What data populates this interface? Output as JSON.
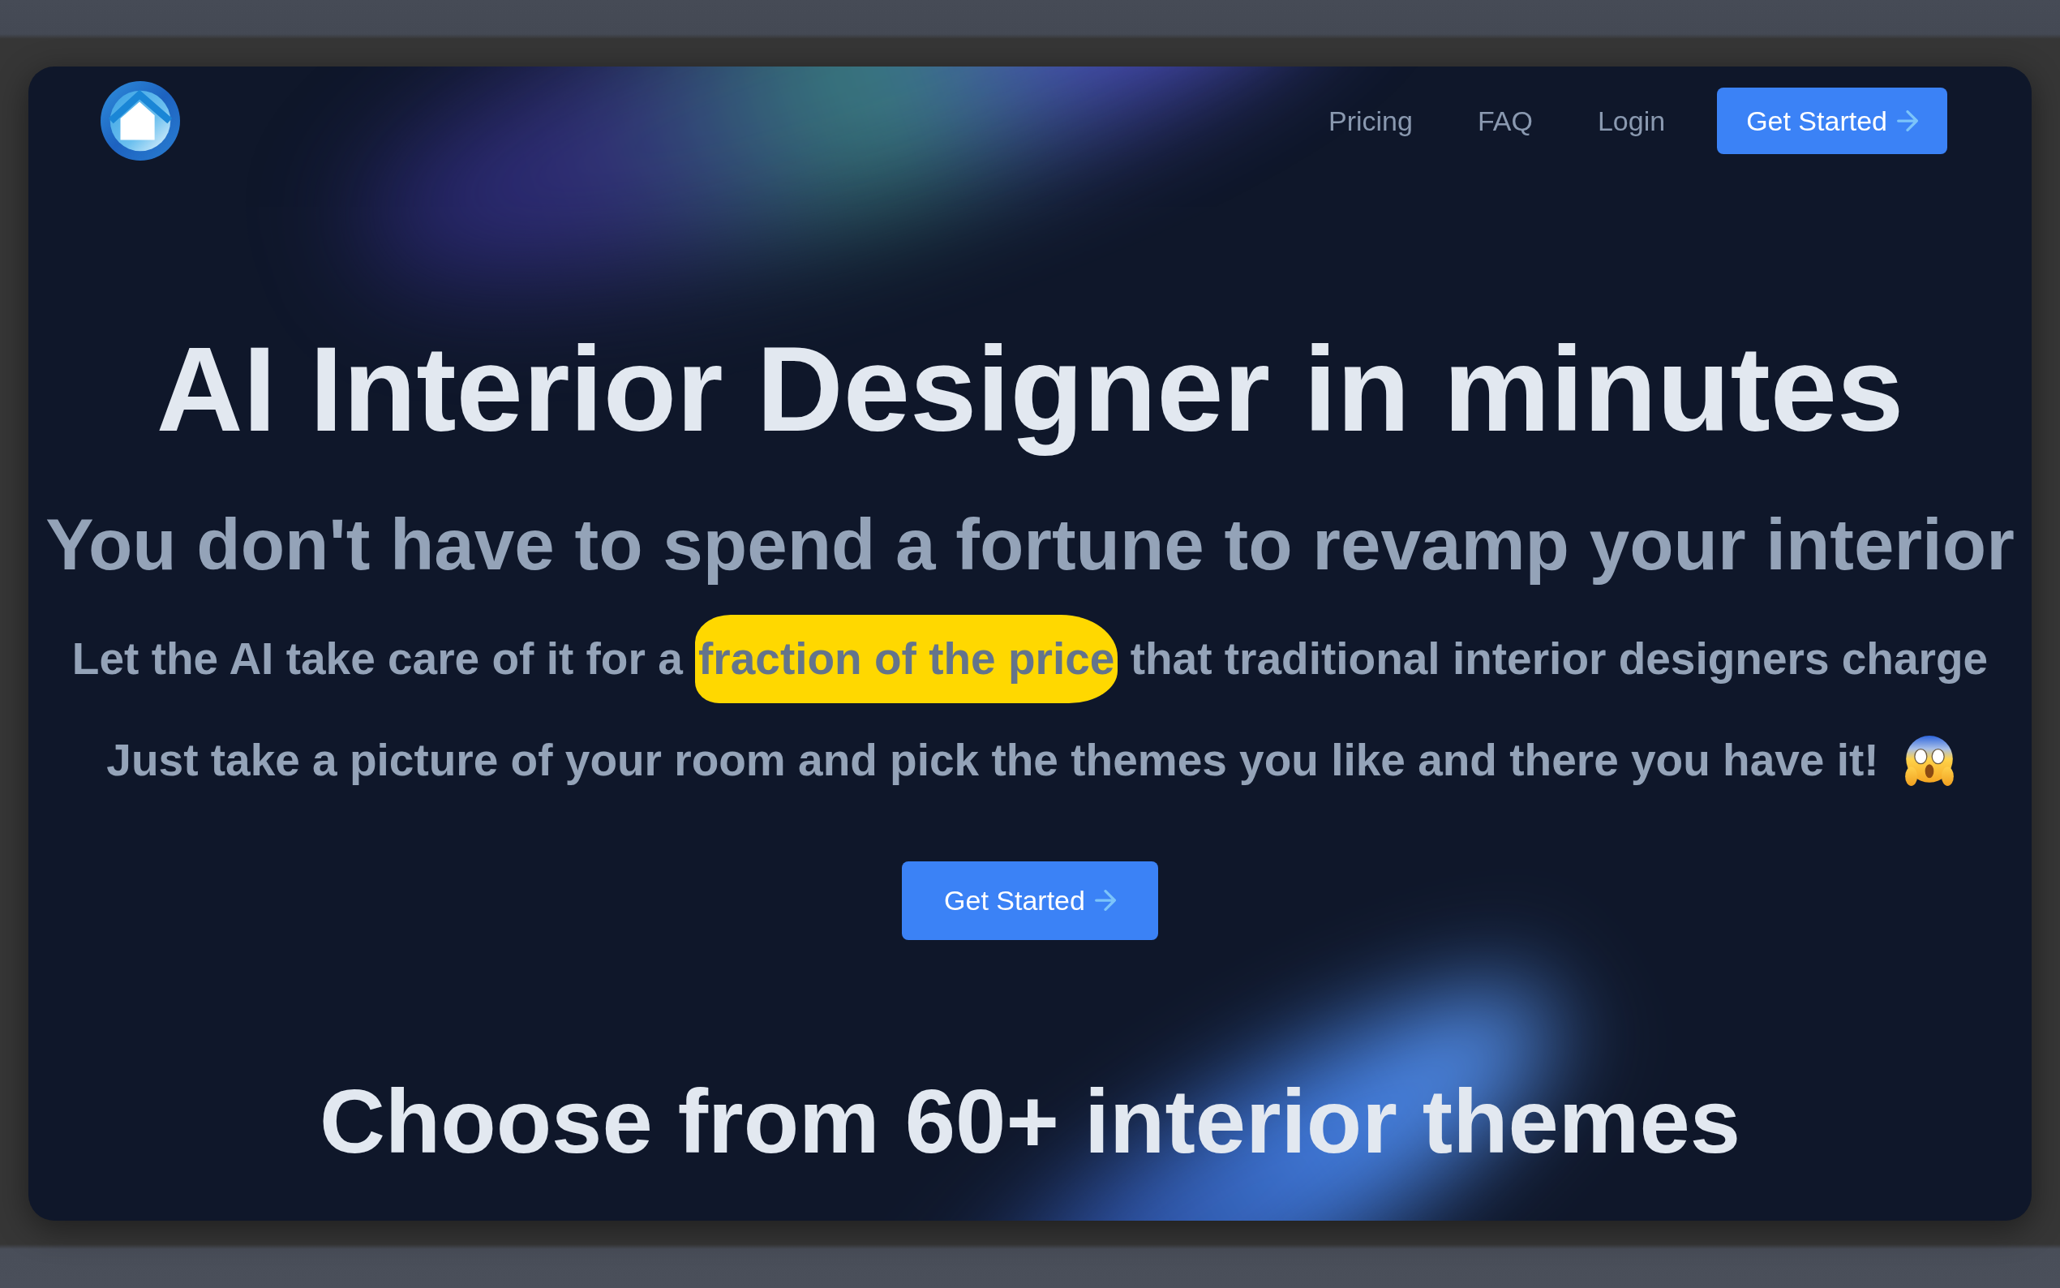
{
  "nav": {
    "links": [
      {
        "label": "Pricing"
      },
      {
        "label": "FAQ"
      },
      {
        "label": "Login"
      }
    ],
    "button": {
      "label": "Get Started"
    }
  },
  "hero": {
    "title": "AI Interior Designer in minutes",
    "subtitle": "You don't have to spend a fortune to revamp your interior",
    "description": [
      {
        "text": "Let the AI take care of it for a",
        "highlighted": false
      },
      {
        "text": "fraction of the price",
        "highlighted": true
      },
      {
        "text": "that traditional interior designers charge",
        "highlighted": false
      }
    ],
    "tagline": "Just take a picture of your room and pick the themes you like and there you have it!",
    "button": {
      "label": "Get Started"
    }
  },
  "themes_section": {
    "heading": "Choose from 60+ interior themes"
  }
}
